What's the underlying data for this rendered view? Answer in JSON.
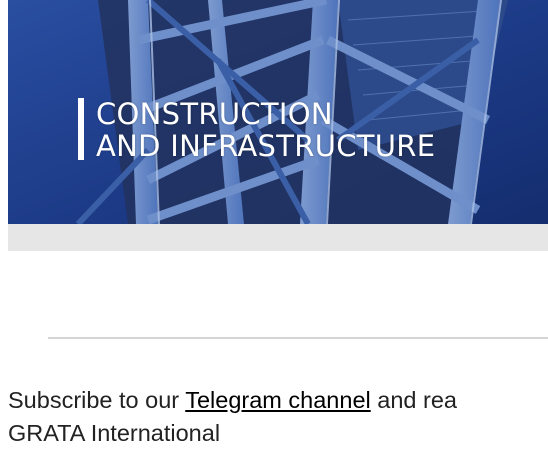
{
  "banner": {
    "title_line1": "CONSTRUCTION",
    "title_line2": "AND INFRASTRUCTURE",
    "background_color": "#1f3e8c",
    "caption_color": "#ffffff"
  },
  "subscribe": {
    "prefix": "Subscribe to our ",
    "link_text": "Telegram channel",
    "suffix": " and rea",
    "line2": "GRATA International"
  },
  "colors": {
    "strip": "#e6e6e6",
    "divider": "#d4d4d4",
    "text": "#222222"
  }
}
